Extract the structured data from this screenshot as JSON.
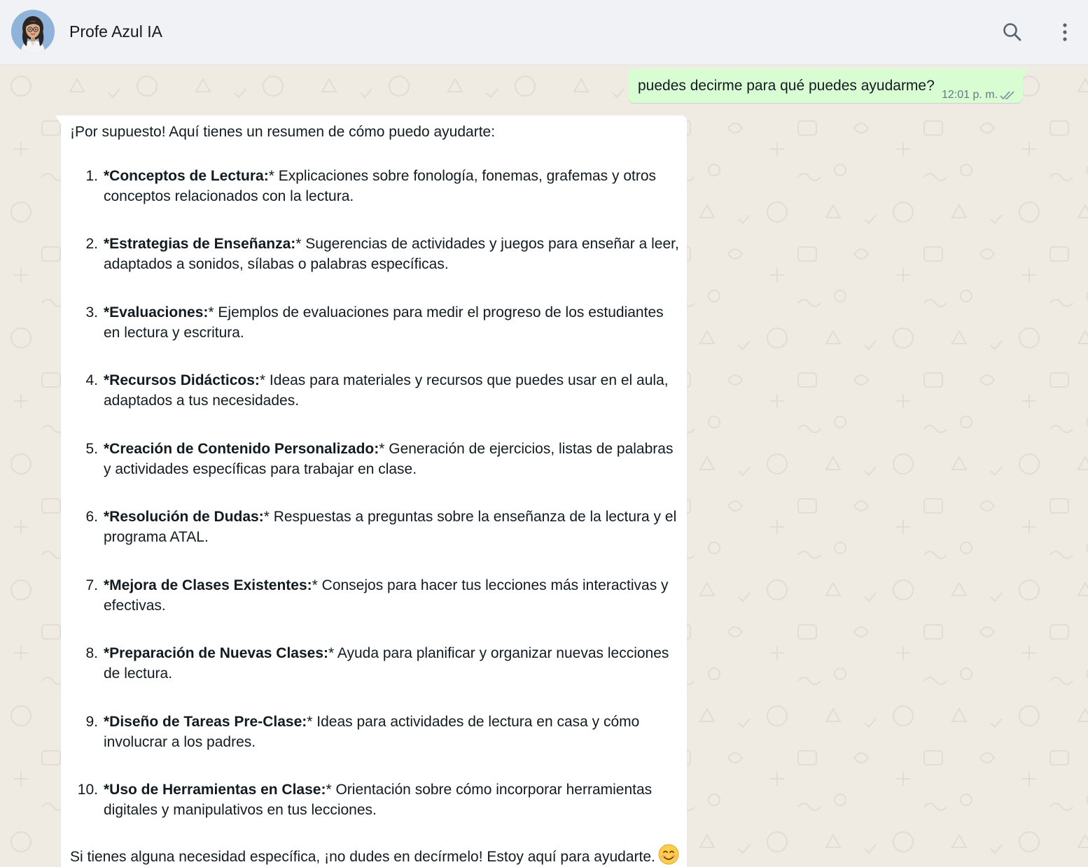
{
  "header": {
    "contact_name": "Profe Azul IA",
    "avatar_icon": "teacher-avatar-icon",
    "search_icon": "search-icon",
    "menu_icon": "kebab-menu-icon"
  },
  "colors": {
    "header_bg": "#f0f2f5",
    "chat_bg": "#efeae2",
    "outgoing_bubble": "#d9fdd3",
    "incoming_bubble": "#ffffff",
    "text": "#111b21",
    "meta_text": "#667781"
  },
  "messages": {
    "outgoing": {
      "text": "puedes decirme para qué puedes ayudarme?",
      "time": "12:01 p. m.",
      "status_icon": "double-check-icon"
    },
    "incoming": {
      "intro": "¡Por supuesto! Aquí tienes un resumen de cómo puedo ayudarte:",
      "items": [
        {
          "num": "1.",
          "title": "*Conceptos de Lectura:",
          "rest": "* Explicaciones sobre fonología, fonemas, grafemas y otros conceptos relacionados con la lectura."
        },
        {
          "num": "2.",
          "title": "*Estrategias de Enseñanza:",
          "rest": "* Sugerencias de actividades y juegos para enseñar a leer, adaptados a sonidos, sílabas o palabras específicas."
        },
        {
          "num": "3.",
          "title": "*Evaluaciones:",
          "rest": "* Ejemplos de evaluaciones para medir el progreso de los estudiantes en lectura y escritura."
        },
        {
          "num": "4.",
          "title": "*Recursos Didácticos:",
          "rest": "* Ideas para materiales y recursos que puedes usar en el aula, adaptados a tus necesidades."
        },
        {
          "num": "5.",
          "title": "*Creación de Contenido Personalizado:",
          "rest": "* Generación de ejercicios, listas de palabras y actividades específicas para trabajar en clase."
        },
        {
          "num": "6.",
          "title": "*Resolución de Dudas:",
          "rest": "* Respuestas a preguntas sobre la enseñanza de la lectura y el programa ATAL."
        },
        {
          "num": "7.",
          "title": "*Mejora de Clases Existentes:",
          "rest": "* Consejos para hacer tus lecciones más interactivas y efectivas."
        },
        {
          "num": "8.",
          "title": "*Preparación de Nuevas Clases:",
          "rest": "* Ayuda para planificar y organizar nuevas lecciones de lectura."
        },
        {
          "num": "9.",
          "title": "*Diseño de Tareas Pre-Clase:",
          "rest": "* Ideas para actividades de lectura en casa y cómo involucrar a los padres."
        },
        {
          "num": "10.",
          "title": "*Uso de Herramientas en Clase:",
          "rest": "* Orientación sobre cómo incorporar herramientas digitales y manipulativos en tus lecciones."
        }
      ],
      "outro": "Si tienes alguna necesidad específica, ¡no dudes en decírmelo! Estoy aquí para ayudarte.",
      "outro_emoji": "smiling-face-emoji"
    }
  }
}
